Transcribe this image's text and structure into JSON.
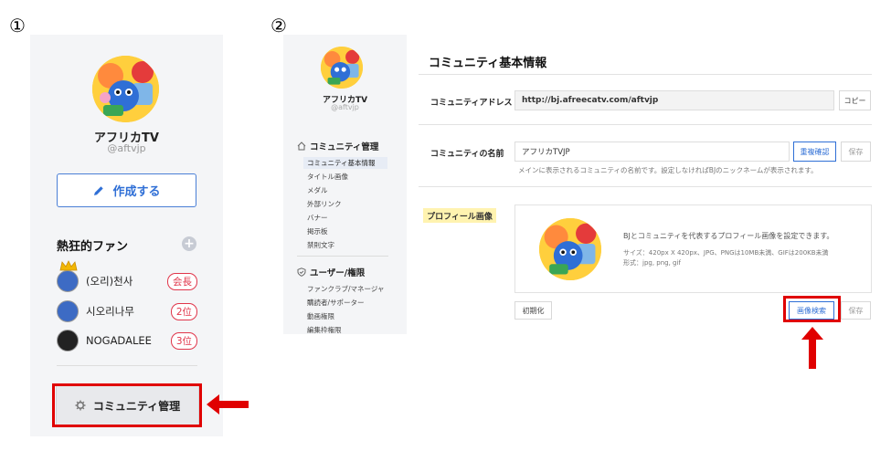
{
  "markers": {
    "one": "①",
    "two": "②"
  },
  "panel1": {
    "name": "アフリカTV",
    "handle": "@aftvjp",
    "create_label": "作成する",
    "fans_title": "熱狂的ファン",
    "fans": [
      {
        "name": "(오리)천사",
        "rank": "会長"
      },
      {
        "name": "시오리나무",
        "rank": "2位"
      },
      {
        "name": "NOGADALEE",
        "rank": "3位"
      }
    ],
    "manage_label": "コミュニティ管理"
  },
  "panel2": {
    "name": "アフリカTV",
    "handle": "@aftvjp",
    "section1_title": "コミュニティ管理",
    "section1_items": [
      "コミュニティ基本情報",
      "タイトル画像",
      "メダル",
      "外部リンク",
      "バナー",
      "掲示板",
      "禁則文字"
    ],
    "section2_title": "ユーザー/権限",
    "section2_items": [
      "ファンクラブ/マネージャー",
      "購読者/サポーター",
      "動画権限",
      "編集枠権限"
    ]
  },
  "content": {
    "title": "コミュニティ基本情報",
    "address_label": "コミュニティアドレス",
    "address_value": "http://bj.afreecatv.com/aftvjp",
    "copy_label": "コピー",
    "name_label": "コミュニティの名前",
    "name_value": "アフリカTVJP",
    "dup_check_label": "重複確認",
    "save_label": "保存",
    "name_help": "メインに表示されるコミュニティの名前です。設定しなければBJのニックネームが表示されます。",
    "profile_label": "プロフィール画像",
    "profile_desc": "BJとコミュニティを代表するプロフィール画像を設定できます。",
    "profile_size": "サイズ：420px X 420px、JPG、PNGは10MB未満、GIFは200KB未満",
    "profile_format": "形式：jpg, png, gif",
    "reset_label": "初期化",
    "search_label": "画像検索",
    "save2_label": "保存"
  },
  "colors": {
    "accent": "#2f6fd6",
    "highlight": "#e00000",
    "rank": "#e0354a",
    "tag": "#fff3b0"
  }
}
